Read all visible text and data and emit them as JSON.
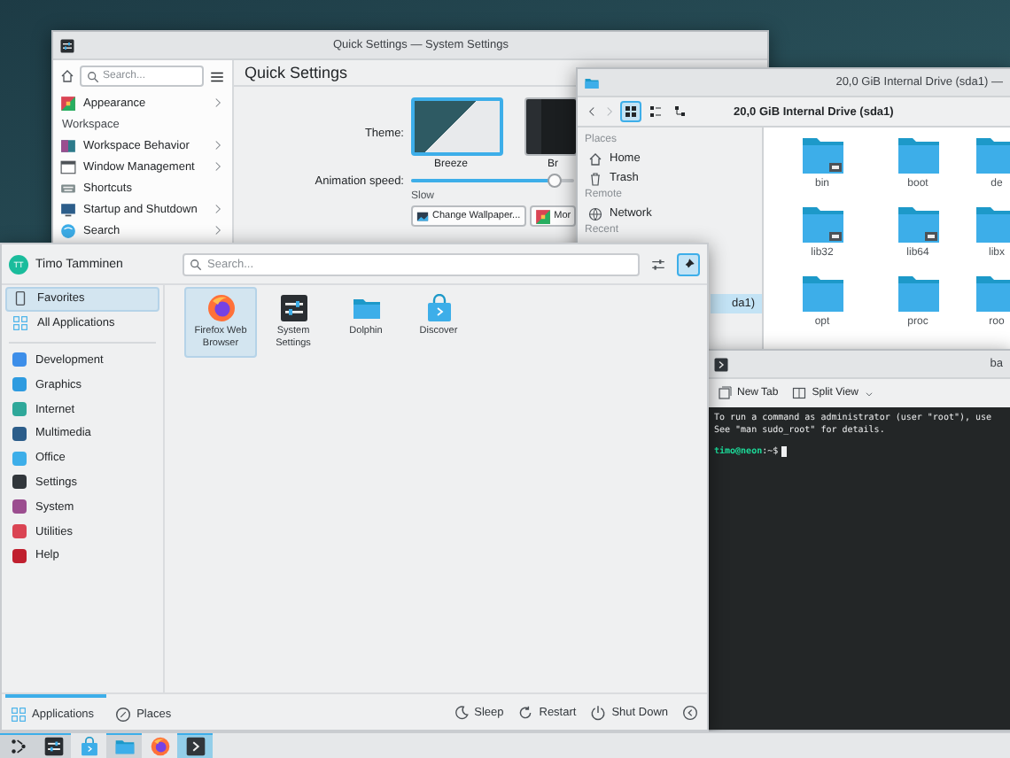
{
  "settings_window": {
    "title": "Quick Settings — System Settings",
    "search": {
      "placeholder": "Search..."
    },
    "sidebar": [
      {
        "kind": "item",
        "label": "Appearance",
        "arrow": true
      },
      {
        "kind": "header",
        "label": "Workspace"
      },
      {
        "kind": "item",
        "label": "Workspace Behavior",
        "arrow": true
      },
      {
        "kind": "item",
        "label": "Window Management",
        "arrow": true
      },
      {
        "kind": "item",
        "label": "Shortcuts",
        "arrow": false
      },
      {
        "kind": "item",
        "label": "Startup and Shutdown",
        "arrow": true
      },
      {
        "kind": "item",
        "label": "Search",
        "arrow": true
      }
    ],
    "page_title": "Quick Settings",
    "theme_label": "Theme:",
    "themes": [
      {
        "name": "Breeze",
        "selected": true,
        "kind": "light"
      },
      {
        "name": "Br",
        "selected": false,
        "kind": "dark"
      }
    ],
    "animation_label": "Animation speed:",
    "animation_speed": {
      "level": 0.88
    },
    "slider_hint": "Slow",
    "buttons": [
      "Change Wallpaper...",
      "Mor"
    ]
  },
  "file_manager": {
    "title": "20,0 GiB Internal Drive (sda1) —",
    "location": "20,0 GiB Internal Drive (sda1)",
    "view_modes": [
      {
        "selected": true
      },
      {
        "selected": false
      },
      {
        "selected": false
      }
    ],
    "places": [
      {
        "kind": "header",
        "label": "Places"
      },
      {
        "kind": "item",
        "label": "Home"
      },
      {
        "kind": "item",
        "label": "Trash"
      },
      {
        "kind": "header",
        "label": "Remote"
      },
      {
        "kind": "item",
        "label": "Network"
      },
      {
        "kind": "header",
        "label": "Recent"
      }
    ],
    "device": {
      "label": "da1)",
      "selected": true
    },
    "folders": [
      {
        "name": "bin",
        "link": true
      },
      {
        "name": "boot",
        "link": false
      },
      {
        "name": "de",
        "link": false
      },
      {
        "name": "lib32",
        "link": true
      },
      {
        "name": "lib64",
        "link": true
      },
      {
        "name": "libx",
        "link": false
      },
      {
        "name": "opt",
        "link": false
      },
      {
        "name": "proc",
        "link": false
      },
      {
        "name": "roo",
        "link": false
      }
    ]
  },
  "terminal": {
    "title": "ba",
    "toolbar": [
      {
        "label": "New Tab",
        "menu": false
      },
      {
        "label": "Split View",
        "menu": true
      }
    ],
    "lines": [
      "To run a command as administrator (user \"root\"), use",
      "See \"man sudo_root\" for details."
    ],
    "prompt_user": "timo@neon",
    "prompt_path": ":~$"
  },
  "launcher": {
    "user": {
      "name": "Timo Tamminen",
      "initials": "TT"
    },
    "search": {
      "placeholder": "Search..."
    },
    "pinned": true,
    "sections": [
      {
        "label": "Favorites",
        "selected": true
      },
      {
        "label": "All Applications",
        "selected": false
      }
    ],
    "categories": [
      {
        "label": "Development",
        "color": "#3d8ee9",
        "selected": false
      },
      {
        "label": "Graphics",
        "color": "#2e9be0",
        "selected": false
      },
      {
        "label": "Internet",
        "color": "#2fa89a",
        "selected": false
      },
      {
        "label": "Multimedia",
        "color": "#2c5d8a",
        "selected": false
      },
      {
        "label": "Office",
        "color": "#3daee9",
        "selected": false
      },
      {
        "label": "Settings",
        "color": "#31363b",
        "selected": false
      },
      {
        "label": "System",
        "color": "#9b4d8f",
        "selected": false
      },
      {
        "label": "Utilities",
        "color": "#da4453",
        "selected": false
      },
      {
        "label": "Help",
        "color": "#c0202f",
        "selected": false
      }
    ],
    "apps": [
      {
        "name": "Firefox Web Browser",
        "selected": true
      },
      {
        "name": "System Settings",
        "selected": false
      },
      {
        "name": "Dolphin",
        "selected": false
      },
      {
        "name": "Discover",
        "selected": false
      }
    ],
    "tabs": [
      {
        "label": "Applications",
        "selected": true
      },
      {
        "label": "Places",
        "selected": false
      }
    ],
    "actions": [
      "Sleep",
      "Restart",
      "Shut Down"
    ]
  },
  "taskbar": {
    "items": [
      {
        "open": true,
        "selected": false
      },
      {
        "open": true,
        "selected": false
      },
      {
        "open": false,
        "selected": false
      },
      {
        "open": true,
        "selected": false
      },
      {
        "open": false,
        "selected": false
      },
      {
        "open": true,
        "selected": true
      }
    ]
  }
}
